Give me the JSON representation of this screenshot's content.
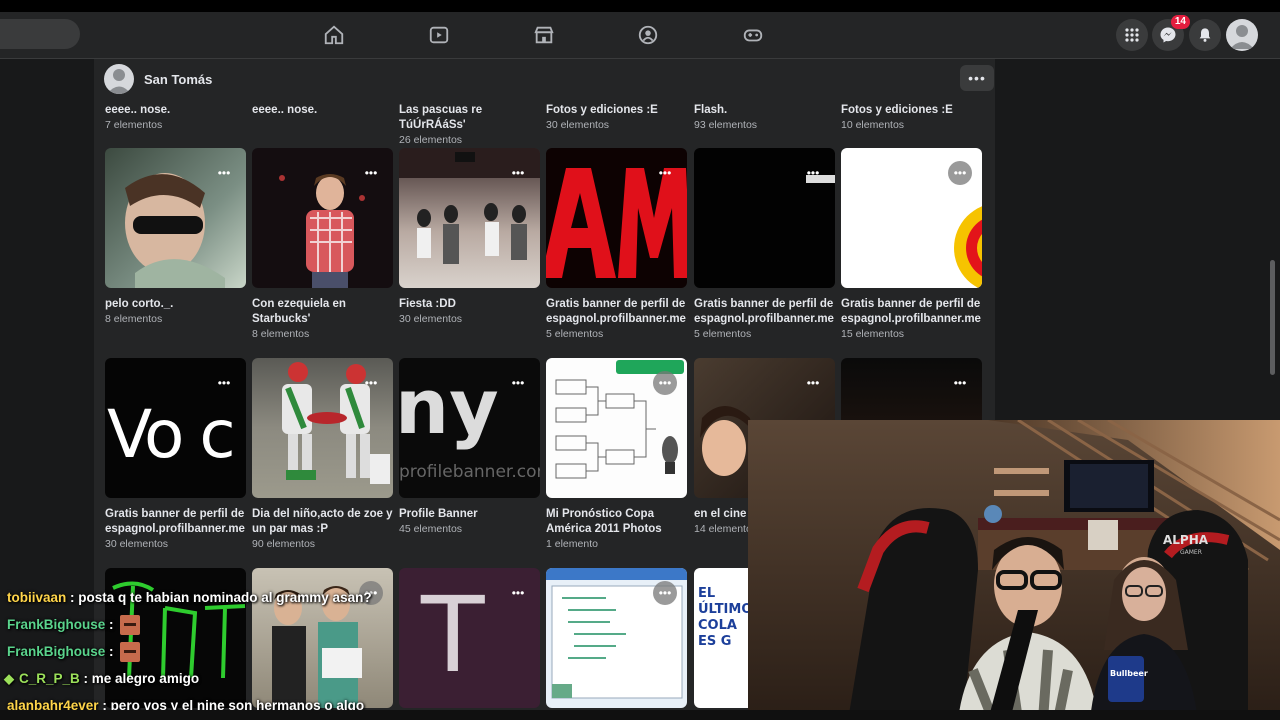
{
  "profile": {
    "name": "San Tomás"
  },
  "topbar": {
    "notifications_badge": "14"
  },
  "albums_top": [
    {
      "title": "eeee.. nose.",
      "count": "7 elementos"
    },
    {
      "title": "eeee.. nose.",
      "count": ""
    },
    {
      "title": "Las pascuas re TúÚrRÁáSs'",
      "count": "26 elementos"
    },
    {
      "title": "Fotos y ediciones :E",
      "count": "30 elementos"
    },
    {
      "title": "Flash.",
      "count": "93 elementos"
    },
    {
      "title": "Fotos y ediciones :E",
      "count": "10 elementos"
    }
  ],
  "albums_row2": [
    {
      "title": "pelo corto._.",
      "count": "8 elementos"
    },
    {
      "title": "Con ezequiela en Starbucks'",
      "count": "8 elementos"
    },
    {
      "title": "Fiesta :DD",
      "count": "30 elementos"
    },
    {
      "title": "Gratis banner de perfil de espagnol.profilbanner.me",
      "count": "5 elementos"
    },
    {
      "title": "Gratis banner de perfil de espagnol.profilbanner.me",
      "count": "5 elementos"
    },
    {
      "title": "Gratis banner de perfil de espagnol.profilbanner.me",
      "count": "15 elementos"
    }
  ],
  "albums_row3": [
    {
      "title": "Gratis banner de perfil de espagnol.profilbanner.me",
      "count": "30 elementos",
      "thumb_text": "Vo c"
    },
    {
      "title": "Dia del niño,acto de zoe y un par mas :P",
      "count": "90 elementos"
    },
    {
      "title": "Profile Banner",
      "count": "45 elementos",
      "thumb_text": "ny",
      "thumb_sub": "profilebanner.cor"
    },
    {
      "title": "Mi Pronóstico Copa América 2011 Photos",
      "count": "1 elemento"
    },
    {
      "title": "en el cine j",
      "count": "14 elemento"
    }
  ],
  "albums_row4": [
    {
      "thumb_text": "T"
    },
    {
      "thumb_text": "EL ÚLTIMO COLA ES G"
    }
  ],
  "chat": [
    {
      "user": "tobiivaan",
      "color": "#ffd54a",
      "message": "posta q te habian nominado al grammy asan?",
      "emote": false
    },
    {
      "user": "FrankBighouse",
      "color": "#5ad48c",
      "message": "",
      "emote": true
    },
    {
      "user": "FrankBighouse",
      "color": "#5ad48c",
      "message": "",
      "emote": true
    },
    {
      "user": "C_R_P_B",
      "color": "#9be05a",
      "message": "me alegro amigo",
      "emote": false
    },
    {
      "user": "alanbahr4ever",
      "color": "#ffd54a",
      "message": "pero vos y el nine son hermanos o algo",
      "emote": false
    }
  ],
  "webcam": {
    "chair_brand": "ALPHA",
    "chair_sub": "GAMER",
    "can_brand": "Bullbeer"
  }
}
